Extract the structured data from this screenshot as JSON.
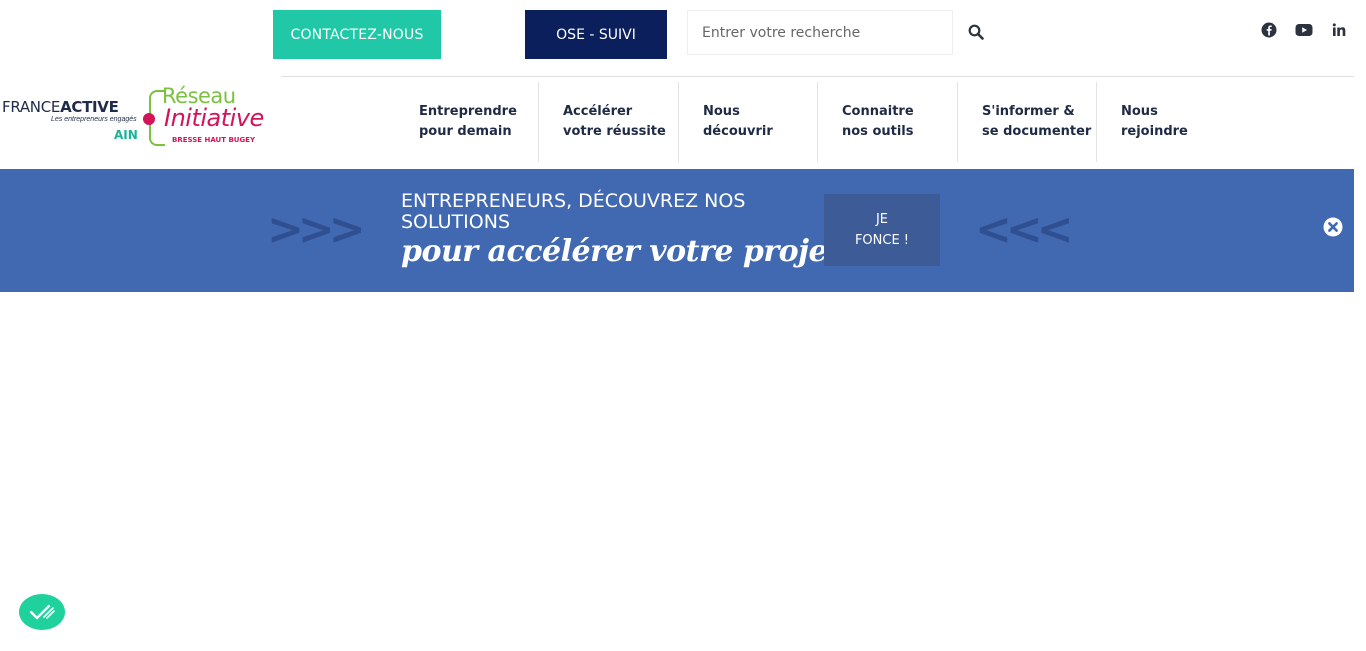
{
  "topbar": {
    "contact_label": "CONTACTEZ-NOUS",
    "ose_label": "OSE - SUIVI",
    "search_placeholder": "Entrer votre recherche",
    "social": [
      "facebook-icon",
      "youtube-icon",
      "linkedin-icon"
    ]
  },
  "logo": {
    "fa_france": "FRANCE",
    "fa_active": "ACTIVE",
    "fa_tagline": "Les entrepreneurs engagés",
    "fa_region": "AIN",
    "ri_reseau": "Réseau",
    "ri_initiative": "Initiative",
    "ri_sub": "BRESSE HAUT BUGEY"
  },
  "nav": [
    {
      "line1": "Entreprendre",
      "line2": "pour demain"
    },
    {
      "line1": "Accélérer",
      "line2": "votre réussite"
    },
    {
      "line1": "Nous",
      "line2": "découvrir"
    },
    {
      "line1": "Connaitre",
      "line2": "nos outils"
    },
    {
      "line1": "S'informer &",
      "line2": "se documenter"
    },
    {
      "line1": "Nous",
      "line2": "rejoindre"
    }
  ],
  "banner": {
    "arrows_left": ">>>",
    "arrows_right": "<<<",
    "line1": "ENTREPRENEURS, DÉCOUVREZ NOS SOLUTIONS",
    "line2": "pour accélérer votre projet !",
    "cta_label": "JE FONCE !"
  },
  "colors": {
    "accent_teal": "#21c8a8",
    "navy": "#0a1f5c",
    "banner_blue": "#4169b2",
    "consent_green": "#1fd19c"
  }
}
